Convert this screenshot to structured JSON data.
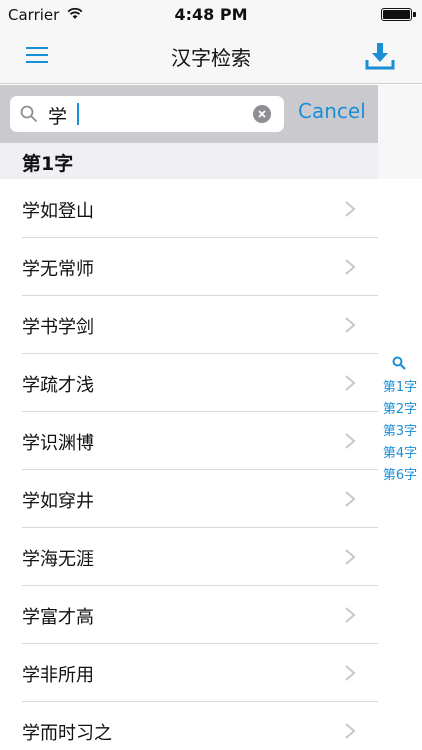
{
  "status_bar": {
    "carrier": "Carrier",
    "time": "4:48 PM"
  },
  "nav": {
    "title": "汉字检索"
  },
  "search": {
    "query": "学",
    "cancel_label": "Cancel"
  },
  "section": {
    "title": "第1字"
  },
  "list": {
    "items": [
      "学如登山",
      "学无常师",
      "学书学剑",
      "学疏才浅",
      "学识渊博",
      "学如穿井",
      "学海无涯",
      "学富才高",
      "学非所用",
      "学而时习之"
    ]
  },
  "index": {
    "items": [
      "第1字",
      "第2字",
      "第3字",
      "第4字",
      "第6字"
    ]
  },
  "colors": {
    "accent": "#1a8fd6",
    "search_bar_bg": "#c9c9ce",
    "section_bg": "#efeff4"
  }
}
